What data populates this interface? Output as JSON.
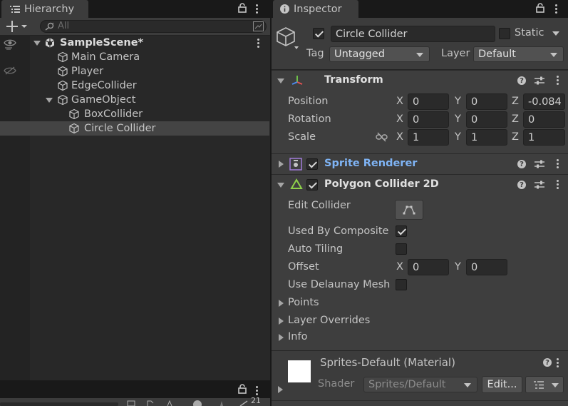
{
  "hierarchy": {
    "tab_label": "Hierarchy",
    "search_placeholder": "All",
    "scene_name": "SampleScene*",
    "items": [
      {
        "label": "Main Camera"
      },
      {
        "label": "Player"
      },
      {
        "label": "EdgeCollider"
      },
      {
        "label": "GameObject"
      },
      {
        "label": "BoxCollider"
      },
      {
        "label": "Circle Collider"
      }
    ]
  },
  "inspector": {
    "tab_label": "Inspector",
    "object_name": "Circle Collider",
    "static_label": "Static",
    "tag_label": "Tag",
    "tag_value": "Untagged",
    "layer_label": "Layer",
    "layer_value": "Default",
    "transform": {
      "title": "Transform",
      "position_label": "Position",
      "rotation_label": "Rotation",
      "scale_label": "Scale",
      "x": "X",
      "y": "Y",
      "z": "Z",
      "position": {
        "x": "0",
        "y": "0",
        "z": "-0.084"
      },
      "rotation": {
        "x": "0",
        "y": "0",
        "z": "0"
      },
      "scale": {
        "x": "1",
        "y": "1",
        "z": "1"
      }
    },
    "sprite_renderer": {
      "title": "Sprite Renderer",
      "color": "#7fb4f5"
    },
    "polygon_collider": {
      "title": "Polygon Collider 2D",
      "edit_collider_label": "Edit Collider",
      "used_by_composite_label": "Used By Composite",
      "auto_tiling_label": "Auto Tiling",
      "offset_label": "Offset",
      "offset": {
        "x": "0",
        "y": "0"
      },
      "use_delaunay_label": "Use Delaunay Mesh",
      "points_label": "Points",
      "layer_overrides_label": "Layer Overrides",
      "info_label": "Info"
    },
    "material": {
      "name": "Sprites-Default (Material)",
      "shader_label": "Shader",
      "shader_value": "Sprites/Default",
      "edit_label": "Edit..."
    }
  },
  "bottom_panel": {
    "partial_text": "21"
  }
}
